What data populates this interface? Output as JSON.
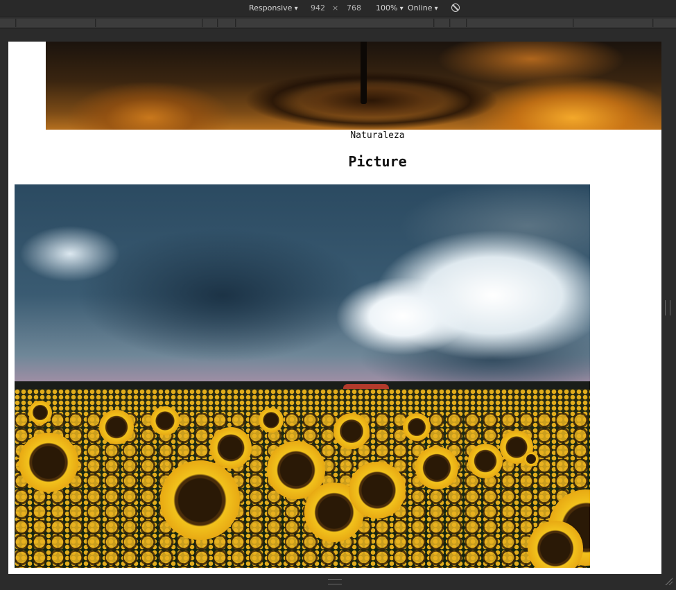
{
  "devtools": {
    "device": "Responsive",
    "width": "942",
    "times": "×",
    "height": "768",
    "zoom": "100%",
    "network": "Online",
    "rotate_icon": "no-cache-icon"
  },
  "page": {
    "banner_image": "water-ripple-sunset-clouds",
    "caption": "Naturaleza",
    "heading": "Picture",
    "photo_image": "sunflower-field-storm-clouds"
  },
  "colors": {
    "toolbar_bg": "#292929",
    "viewport_bg": "#ffffff",
    "sunflower_yellow": "#e7a813"
  }
}
